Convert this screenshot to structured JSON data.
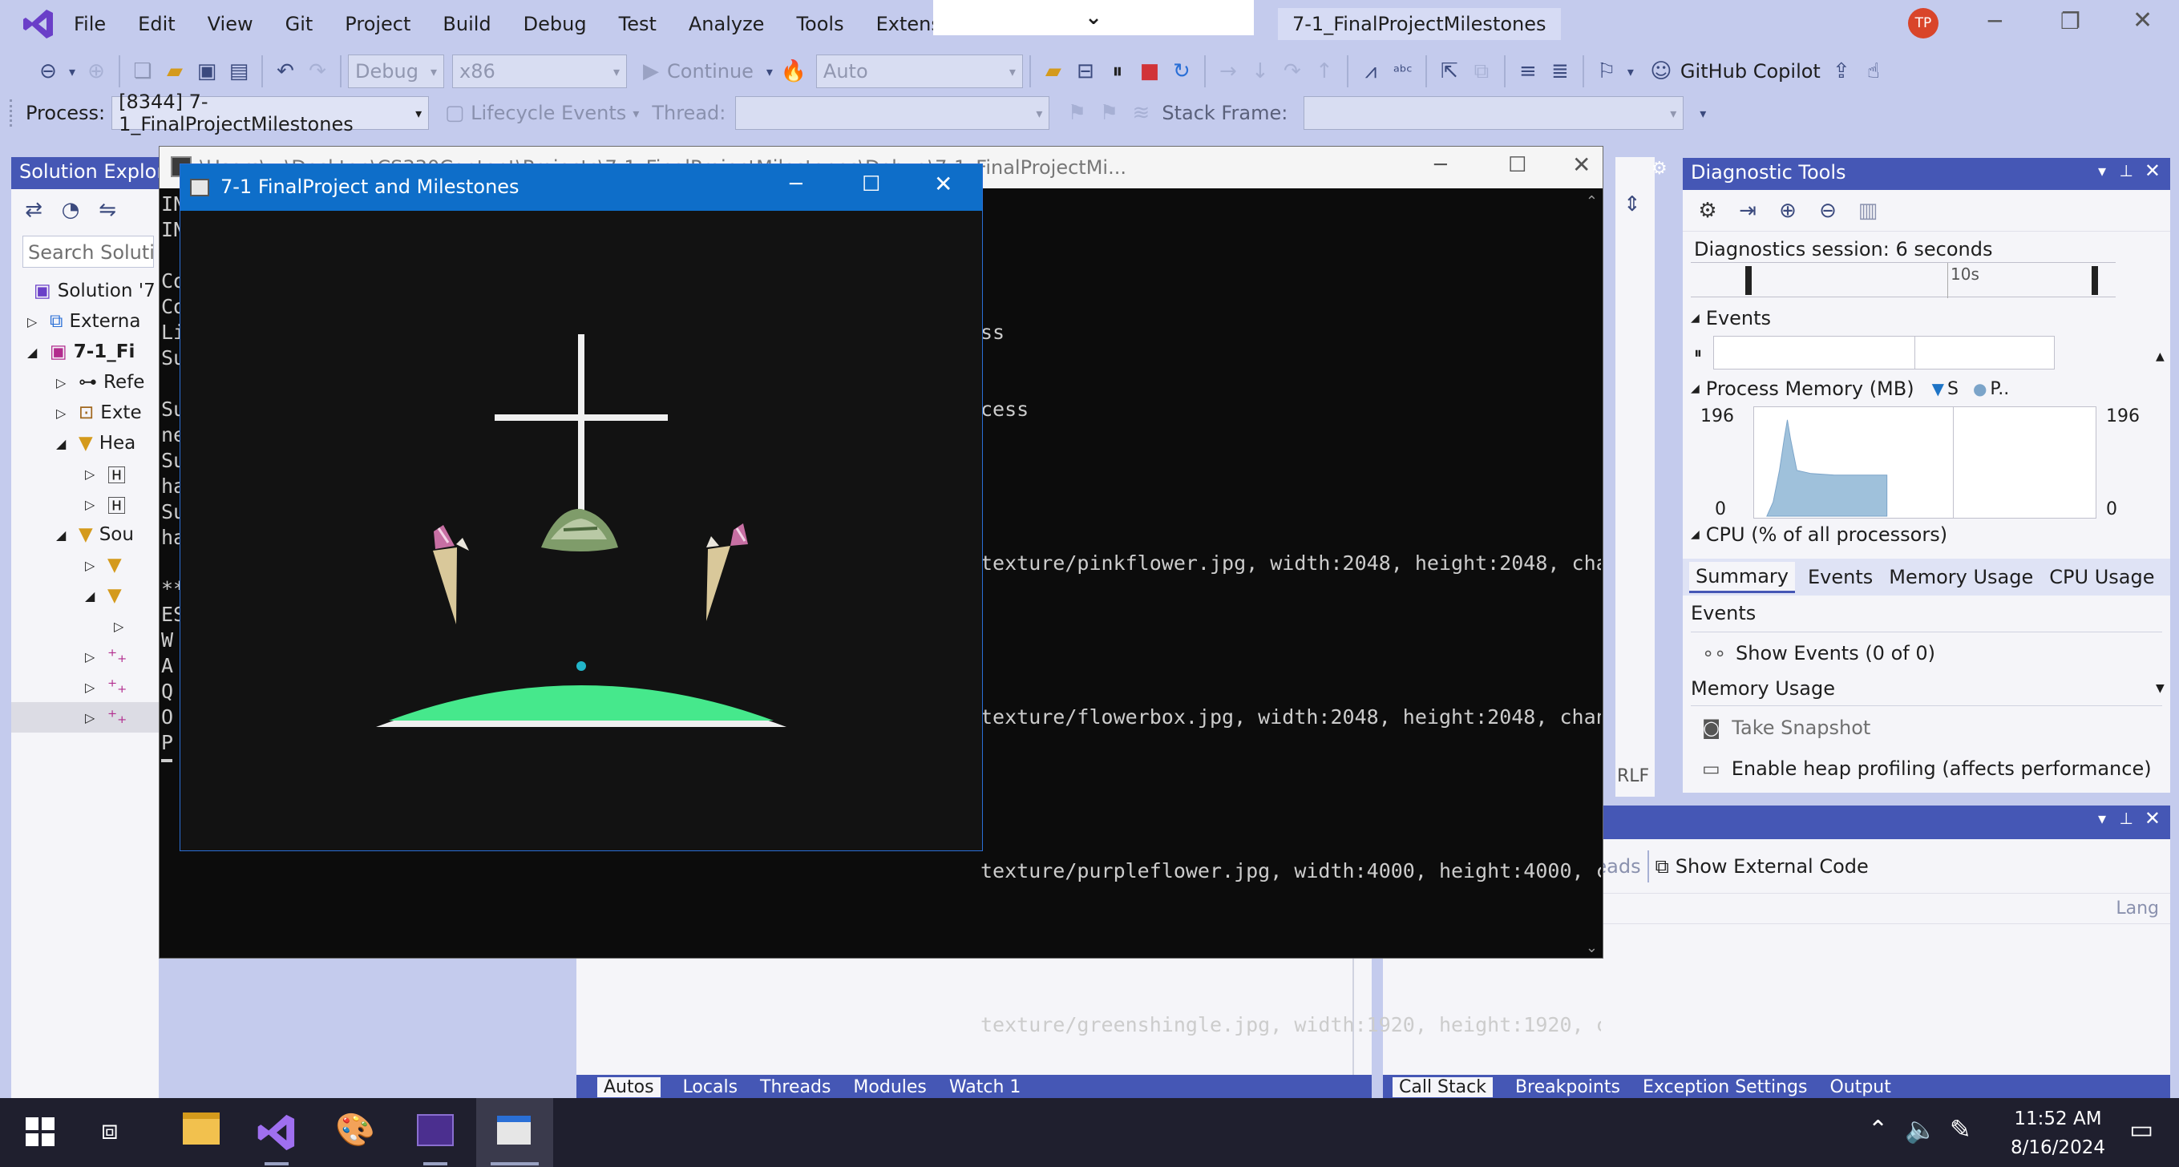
{
  "app": {
    "tab_title": "7-1_FinalProjectMilestones",
    "avatar": "TP"
  },
  "menu": [
    "File",
    "Edit",
    "View",
    "Git",
    "Project",
    "Build",
    "Debug",
    "Test",
    "Analyze",
    "Tools",
    "Extensions"
  ],
  "toolbar": {
    "config": "Debug",
    "platform": "x86",
    "continue": "Continue",
    "auto": "Auto",
    "copilot": "GitHub Copilot"
  },
  "debugbar": {
    "process_label": "Process:",
    "process_value": "[8344] 7-1_FinalProjectMilestones",
    "lifecycle": "Lifecycle Events",
    "thread_label": "Thread:",
    "stack_label": "Stack Frame:"
  },
  "solution": {
    "title": "Solution Explore",
    "search": "Search Solution",
    "items": [
      "Solution '7",
      "Externa",
      "7-1_Fi",
      "Refe",
      "Exte",
      "Hea",
      "",
      "",
      "Sou",
      "",
      "",
      "",
      "",
      "",
      ""
    ]
  },
  "console": {
    "title": "\\Users\\...\\Desktop\\CS330Content\\Projects\\7-1_FinalProjectMilestones\\Debug\\7-1_FinalProjectMi...",
    "left_chars": [
      "IN",
      "IN",
      "",
      "Co",
      "Co",
      "Li",
      "Su",
      "",
      "Su",
      "ne",
      "Su",
      "ha",
      "Su",
      "ha",
      "",
      "**",
      "ES",
      "W",
      "A",
      "Q",
      "O",
      "P"
    ],
    "lines": [
      "ss",
      "cess",
      "",
      "texture/pinkflower.jpg, width:2048, height:2048, cha",
      "",
      "texture/flowerbox.jpg, width:2048, height:2048, chan",
      "",
      "texture/purpleflower.jpg, width:4000, height:4000, c",
      "",
      "texture/greenshingle.jpg, width:1920, height:1920, c"
    ]
  },
  "gl": {
    "title": "7-1 FinalProject and Milestones"
  },
  "diag": {
    "title": "Diagnostic Tools",
    "session": "Diagnostics session: 6 seconds",
    "tick": "10s",
    "events": "Events",
    "memory": "Process Memory (MB)",
    "legend_s": "S",
    "legend_p": "P..",
    "mem_max": "196",
    "mem_min": "0",
    "cpu": "CPU (% of all processors)",
    "tabs": [
      "Summary",
      "Events",
      "Memory Usage",
      "CPU Usage"
    ],
    "events_h": "Events",
    "show_events": "Show Events (0 of 0)",
    "memusage_h": "Memory Usage",
    "snapshot": "Take Snapshot",
    "heap": "Enable heap profiling (affects performance)"
  },
  "threads": {
    "view_all": "View all Threads",
    "show_ext": "Show External Code",
    "lang": "Lang"
  },
  "bottom_tabs_left": [
    "Autos",
    "Locals",
    "Threads",
    "Modules",
    "Watch 1"
  ],
  "bottom_tabs_right": [
    "Call Stack",
    "Breakpoints",
    "Exception Settings",
    "Output"
  ],
  "crlf": "RLF",
  "taskbar": {
    "time": "11:52 AM",
    "date": "8/16/2024"
  }
}
